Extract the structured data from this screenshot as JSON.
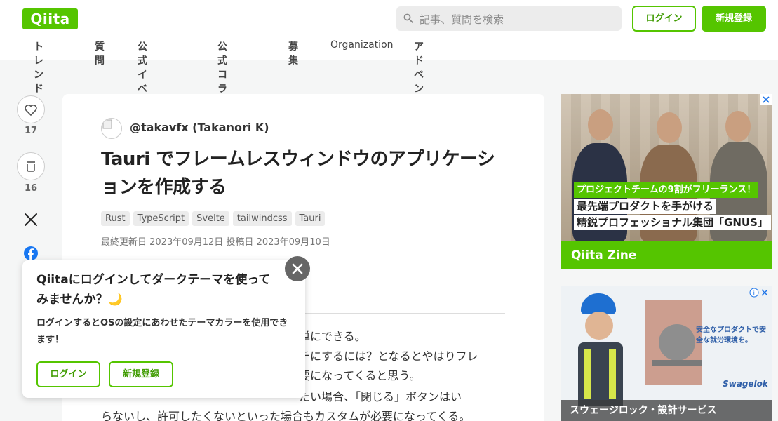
{
  "header": {
    "logo": "Qiita",
    "search_placeholder": "記事、質問を検索",
    "login_label": "ログイン",
    "signup_label": "新規登録"
  },
  "nav": {
    "items": [
      "トレンド",
      "質問",
      "公式イベント",
      "公式コラム",
      "募集",
      "Organization",
      "アドベントカレンダー"
    ]
  },
  "sidebar": {
    "like_count": "17",
    "stock_count": "16",
    "share_x_icon": "x-icon",
    "share_facebook_icon": "facebook-icon",
    "share_hatena_icon": "hatena-bookmark-icon",
    "more_icon": "more-icon"
  },
  "article": {
    "author": "@takavfx (Takanori K)",
    "title": "Tauri でフレームレスウィンドウのアプリケーションを作成する",
    "tags": [
      "Rust",
      "TypeScript",
      "Svelte",
      "tailwindcss",
      "Tauri"
    ],
    "dates": "最終更新日 2023年09月12日  投稿日 2023年09月10日",
    "body_line1_visible": "単にできる。",
    "body_line2_visible": "チにするには？となるとやはりフレ",
    "body_line3_visible": "要になってくると思う。",
    "body_line4_visible": "たい場合、「閉じる」ボタンはい",
    "body_line5": "らないし、許可したくないといった場合もカスタムが必要になってくる。"
  },
  "popup": {
    "title": "Qiitaにログインしてダークテーマを使ってみませんか？🌙",
    "body": "ログインするとOSの設定にあわせたテーマカラーを使用できます！",
    "login_label": "ログイン",
    "signup_label": "新規登録"
  },
  "ads": {
    "ad1": {
      "line1_green": "プロジェクトチームの9割がフリーランス！",
      "line2": "最先端プロダクトを手がける",
      "line3": "精鋭プロフェッショナル集団「GNUS」",
      "footer": "Qiita Zine"
    },
    "ad2": {
      "copy": "安全なプロダクトで安全な就労環境を。",
      "brand": "Swagelok",
      "footer": "スウェージロック・設計サービス"
    }
  },
  "colors": {
    "accent": "#55c500",
    "accent_text": "#3f9b00",
    "page_bg": "#f5f6f6"
  }
}
